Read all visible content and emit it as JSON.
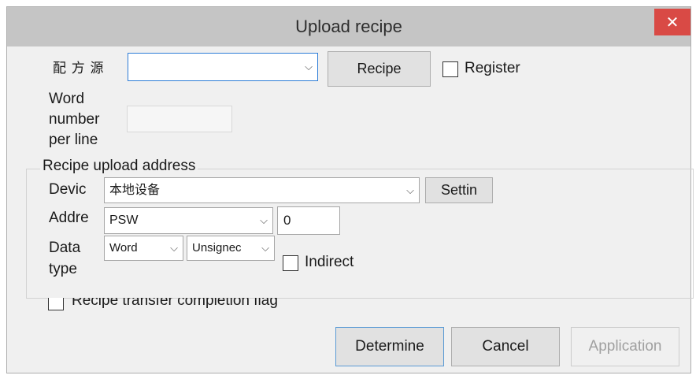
{
  "window": {
    "title": "Upload recipe",
    "close_glyph": "✕"
  },
  "source": {
    "label": "配 方 源",
    "combo_value": "",
    "recipe_button": "Recipe",
    "register_label": "Register"
  },
  "word_number": {
    "label_line1": "Word",
    "label_line2": "number",
    "label_line3": "per line",
    "value": ""
  },
  "upload_group": {
    "title": "Recipe upload address",
    "device": {
      "label": "Devic",
      "value": "本地设备",
      "settings_button": "Settin"
    },
    "address": {
      "label": "Addre",
      "type_value": "PSW",
      "offset_value": "0"
    },
    "data_type": {
      "label_line1": "Data",
      "label_line2": "type",
      "type_value": "Word",
      "sign_value": "Unsignec",
      "indirect_label": "Indirect"
    }
  },
  "completion_flag": {
    "label": "Recipe transfer completion flag"
  },
  "footer": {
    "determine": "Determine",
    "cancel": "Cancel",
    "application": "Application"
  },
  "icons": {
    "chevron": "chevron-down-icon",
    "close": "close-icon"
  },
  "colors": {
    "close_bg": "#d94a45",
    "titlebar": "#c5c5c5",
    "combo_focus": "#2e7dd7",
    "disabled_text": "#a0a0a0",
    "determine_border": "#5b9bd5"
  }
}
